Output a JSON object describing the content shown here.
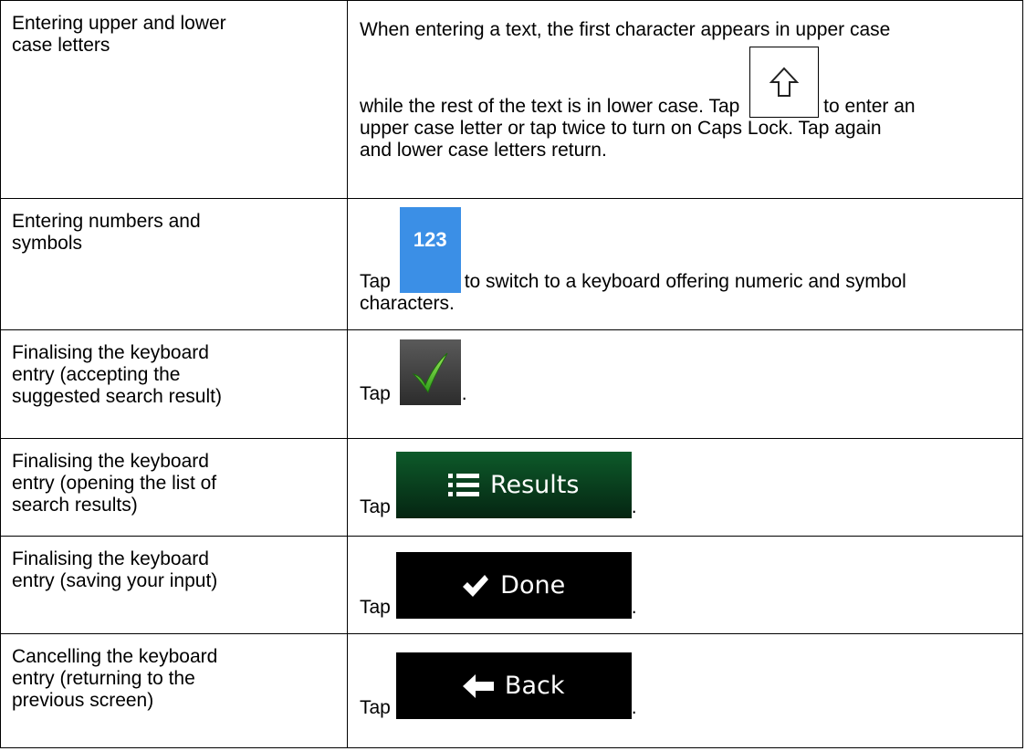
{
  "rows": [
    {
      "label_lines": [
        "Entering upper and lower",
        "case letters"
      ],
      "desc": {
        "line1": "When entering a text, the first character appears in upper case",
        "line2_pre": "while the rest of the text is in lower case. Tap",
        "line2_post": "to enter an",
        "line3": "upper case letter or tap twice to turn on Caps Lock. Tap again",
        "line4": "and lower case letters return.",
        "icon": "shift-arrow-icon"
      }
    },
    {
      "label_lines": [
        "Entering numbers and",
        "symbols"
      ],
      "desc": {
        "tap": "Tap",
        "button_text": "123",
        "post": "to switch to a keyboard offering numeric and symbol",
        "line2": "characters.",
        "button_color": "#3b8fe6"
      }
    },
    {
      "label_lines": [
        "Finalising the keyboard",
        "entry (accepting the",
        "suggested search result)"
      ],
      "desc": {
        "tap": "Tap",
        "end": ".",
        "icon": "green-checkmark-icon"
      }
    },
    {
      "label_lines": [
        "Finalising the keyboard",
        "entry (opening the list of",
        "search results)"
      ],
      "desc": {
        "tap": "Tap",
        "end": ".",
        "button_text": "Results",
        "icon": "list-icon"
      }
    },
    {
      "label_lines": [
        "Finalising the keyboard",
        "entry (saving your input)"
      ],
      "desc": {
        "tap": "Tap",
        "end": ".",
        "button_text": "Done",
        "icon": "checkmark-icon"
      }
    },
    {
      "label_lines": [
        "Cancelling the keyboard",
        "entry (returning to the",
        "previous screen)"
      ],
      "desc": {
        "tap": "Tap",
        "end": ".",
        "button_text": "Back",
        "icon": "left-arrow-icon"
      }
    }
  ]
}
